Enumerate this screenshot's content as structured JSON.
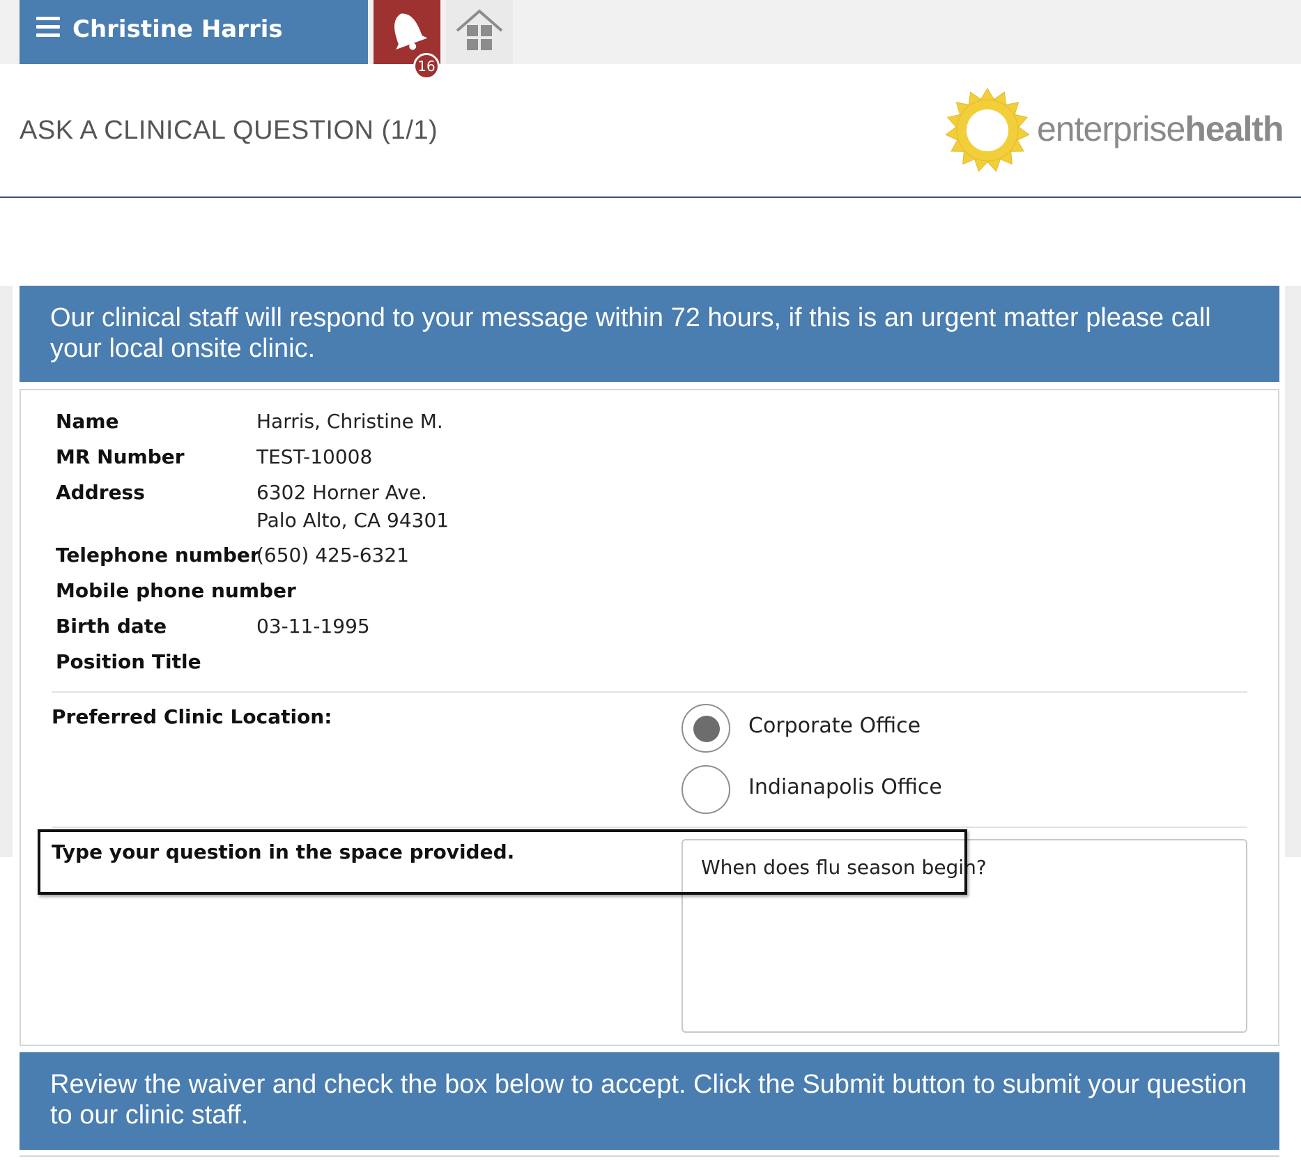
{
  "header": {
    "user_name": "Christine Harris",
    "notification_count": "16"
  },
  "page": {
    "title": "ASK A CLINICAL QUESTION (1/1)"
  },
  "logo": {
    "text_light": "enterprise",
    "text_bold": "health",
    "sun_color": "#f2cf3a"
  },
  "notice": {
    "text": "Our clinical staff will respond to your message within 72 hours, if this is an urgent matter please call your local onsite clinic."
  },
  "patient": {
    "name_label": "Name",
    "name_value": "Harris, Christine M.",
    "mr_label": "MR Number",
    "mr_value": "TEST-10008",
    "address_label": "Address",
    "address_line1": "6302 Horner Ave.",
    "address_line2": "Palo Alto, CA 94301",
    "phone_label": "Telephone number",
    "phone_value": "(650) 425-6321",
    "mobile_label": "Mobile phone number",
    "mobile_value": "",
    "birth_label": "Birth date",
    "birth_value": "03-11-1995",
    "position_label": "Position Title",
    "position_value": ""
  },
  "clinic": {
    "label": "Preferred Clinic Location:",
    "options": [
      {
        "label": "Corporate Office",
        "selected": true
      },
      {
        "label": "Indianapolis Office",
        "selected": false
      }
    ]
  },
  "question": {
    "label": "Type your question in the space provided.",
    "value": "When does flu season begin?"
  },
  "waiver": {
    "text": "Review the waiver and check the box below to accept. Click the Submit button to submit your question to our clinic staff."
  },
  "colors": {
    "header_blue": "#4a7db0",
    "bell_red": "#9d3230"
  }
}
